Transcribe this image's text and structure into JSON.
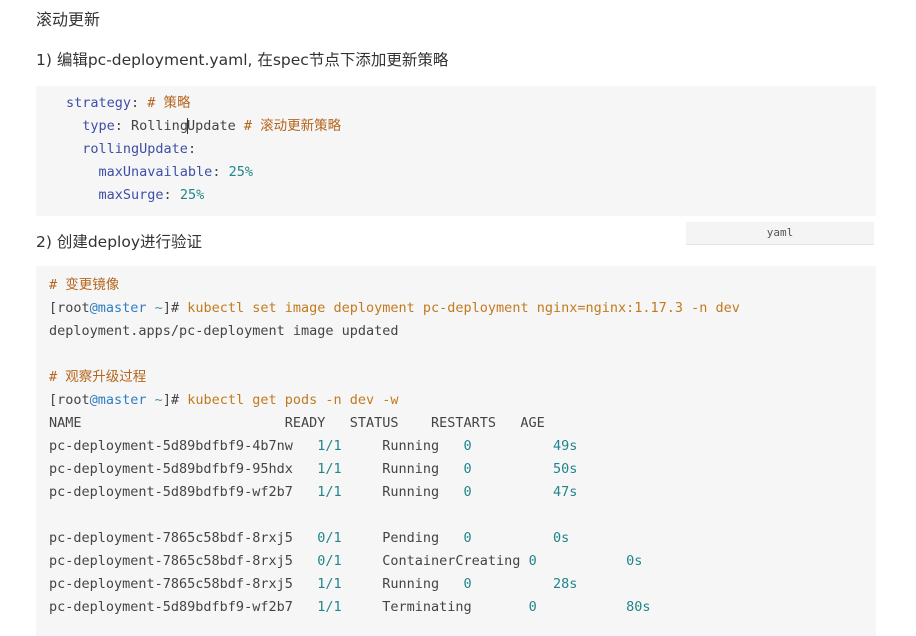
{
  "section_title": "滚动更新",
  "step1_text": "1) 编辑pc-deployment.yaml, 在spec节点下添加更新策略",
  "yaml_block": {
    "lines": [
      {
        "indent": "",
        "key": "strategy",
        "value": "",
        "comment": "# 策略"
      },
      {
        "indent": "  ",
        "key": "type",
        "value": "RollingUpdate",
        "comment": "# 滚动更新策略"
      },
      {
        "indent": "  ",
        "key": "rollingUpdate",
        "value": "",
        "comment": ""
      },
      {
        "indent": "    ",
        "key": "maxUnavailable",
        "value": "25%",
        "comment": ""
      },
      {
        "indent": "    ",
        "key": "maxSurge",
        "value": "25%",
        "comment": ""
      }
    ],
    "lang_tag": "yaml"
  },
  "step2_text": "2) 创建deploy进行验证",
  "shell_block": {
    "comment1": "# 变更镜像",
    "prompt_user": "[root",
    "prompt_at": "@master",
    "prompt_tilde": " ~",
    "prompt_end": "]#",
    "cmd1": " kubectl set image deployment pc-deployment nginx=nginx:1.17.3 -n dev",
    "out1": "deployment.apps/pc-deployment image updated",
    "comment2": "# 观察升级过程",
    "cmd2": " kubectl get pods -n dev -w",
    "table_header": "NAME                         READY   STATUS    RESTARTS   AGE",
    "rows_group1": [
      {
        "name": "pc-deployment-5d89bdfbf9-4b7nw",
        "ready": "1/1",
        "status": "Running",
        "restarts": "0",
        "age": "49s"
      },
      {
        "name": "pc-deployment-5d89bdfbf9-95hdx",
        "ready": "1/1",
        "status": "Running",
        "restarts": "0",
        "age": "50s"
      },
      {
        "name": "pc-deployment-5d89bdfbf9-wf2b7",
        "ready": "1/1",
        "status": "Running",
        "restarts": "0",
        "age": "47s"
      }
    ],
    "rows_group2": [
      {
        "name": "pc-deployment-7865c58bdf-8rxj5",
        "ready": "0/1",
        "status": "Pending",
        "restarts": "0",
        "age": "0s"
      },
      {
        "name": "pc-deployment-7865c58bdf-8rxj5",
        "ready": "0/1",
        "status": "ContainerCreating",
        "restarts": "0",
        "age": "0s"
      },
      {
        "name": "pc-deployment-7865c58bdf-8rxj5",
        "ready": "1/1",
        "status": "Running",
        "restarts": "0",
        "age": "28s"
      },
      {
        "name": "pc-deployment-5d89bdfbf9-wf2b7",
        "ready": "1/1",
        "status": "Terminating",
        "restarts": "0",
        "age": "80s"
      }
    ]
  },
  "colors": {
    "code_bg": "#f6f6f7",
    "keyword": "#3e4fa6",
    "comment": "#b5651d",
    "number": "#21858a",
    "command": "#c27a1e",
    "host": "#2f7dc2"
  }
}
